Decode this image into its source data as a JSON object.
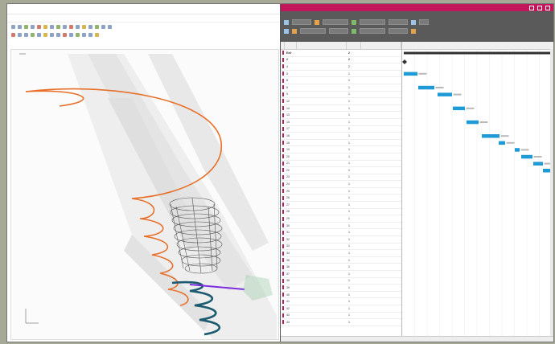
{
  "colors": {
    "backdrop": "#a7a997",
    "gantt_title_bar": "#c2185b",
    "ribbon": "#5a5a5a",
    "task_bar": "#1e9ad6",
    "summary_bar": "#2f2f2f",
    "spiral_orange": "#e8702a",
    "spiral_teal": "#1b5a70",
    "purple_segment": "#7a2ee0"
  },
  "icons": [
    "undo-icon",
    "redo-icon",
    "save-icon",
    "zoom-icon",
    "select-icon",
    "draw-line-icon",
    "grid-icon",
    "layer-icon"
  ],
  "gantt": {
    "tasks": [
      {
        "id": "Ex0",
        "duration": "2"
      },
      {
        "id": "2",
        "duration": "2"
      },
      {
        "id": "4",
        "duration": "2"
      },
      {
        "id": "5",
        "duration": "1"
      },
      {
        "id": "8",
        "duration": "1"
      },
      {
        "id": "6",
        "duration": "1"
      },
      {
        "id": "9",
        "duration": "1"
      },
      {
        "id": "12",
        "duration": "1"
      },
      {
        "id": "14",
        "duration": "1"
      },
      {
        "id": "13",
        "duration": "1"
      },
      {
        "id": "15",
        "duration": "1"
      },
      {
        "id": "17",
        "duration": "1"
      },
      {
        "id": "16",
        "duration": "1"
      },
      {
        "id": "18",
        "duration": "1"
      },
      {
        "id": "19",
        "duration": "1"
      },
      {
        "id": "20",
        "duration": "1"
      },
      {
        "id": "21",
        "duration": "1"
      },
      {
        "id": "22",
        "duration": "1"
      },
      {
        "id": "23",
        "duration": "1"
      },
      {
        "id": "24",
        "duration": "1"
      },
      {
        "id": "25",
        "duration": "1"
      },
      {
        "id": "26",
        "duration": "1"
      },
      {
        "id": "27",
        "duration": "1"
      },
      {
        "id": "28",
        "duration": "1"
      },
      {
        "id": "29",
        "duration": "1"
      },
      {
        "id": "30",
        "duration": "1"
      },
      {
        "id": "31",
        "duration": "1"
      },
      {
        "id": "32",
        "duration": "1"
      },
      {
        "id": "33",
        "duration": "1"
      },
      {
        "id": "34",
        "duration": "1"
      },
      {
        "id": "35",
        "duration": "1"
      },
      {
        "id": "36",
        "duration": "1"
      },
      {
        "id": "37",
        "duration": "1"
      },
      {
        "id": "38",
        "duration": "1"
      },
      {
        "id": "39",
        "duration": "1"
      },
      {
        "id": "40",
        "duration": "1"
      },
      {
        "id": "41",
        "duration": "1"
      },
      {
        "id": "42",
        "duration": "1"
      },
      {
        "id": "43",
        "duration": "1"
      },
      {
        "id": "44",
        "duration": "1"
      }
    ]
  }
}
